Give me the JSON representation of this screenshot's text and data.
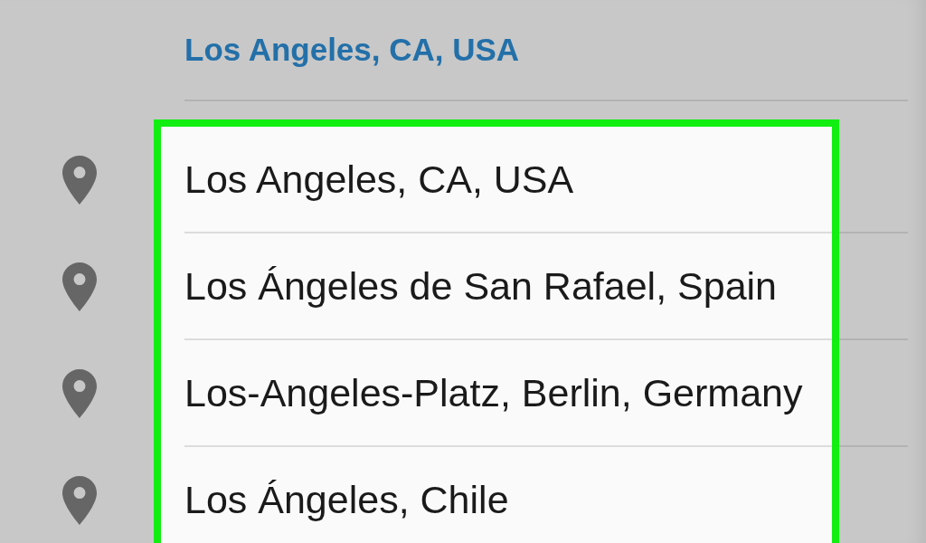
{
  "current_location": "Los Angeles, CA, USA",
  "suggestions": {
    "highlighted": true,
    "items": [
      {
        "label": "Los Angeles, CA, USA"
      },
      {
        "label": "Los Ángeles de San Rafael, Spain"
      },
      {
        "label": "Los-Angeles-Platz, Berlin, Germany"
      },
      {
        "label": "Los Ángeles, Chile"
      }
    ]
  }
}
